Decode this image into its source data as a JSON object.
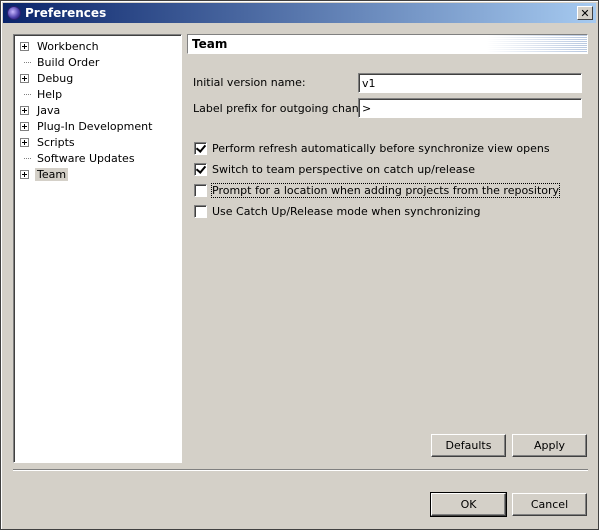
{
  "window": {
    "title": "Preferences",
    "close_glyph": "✕"
  },
  "tree": {
    "items": [
      {
        "label": "Workbench",
        "expandable": true
      },
      {
        "label": "Build Order",
        "expandable": false
      },
      {
        "label": "Debug",
        "expandable": true
      },
      {
        "label": "Help",
        "expandable": false
      },
      {
        "label": "Java",
        "expandable": true
      },
      {
        "label": "Plug-In Development",
        "expandable": true
      },
      {
        "label": "Scripts",
        "expandable": true
      },
      {
        "label": "Software Updates",
        "expandable": false
      },
      {
        "label": "Team",
        "expandable": true,
        "selected": true
      }
    ]
  },
  "page": {
    "title": "Team",
    "fields": {
      "initial_version_label": "Initial version name:",
      "initial_version_value": "v1",
      "label_prefix_label": "Label prefix for outgoing changes:",
      "label_prefix_value": ">"
    },
    "checkboxes": [
      {
        "label": "Perform refresh automatically before synchronize view opens",
        "checked": true
      },
      {
        "label": "Switch to team perspective on catch up/release",
        "checked": true
      },
      {
        "label": "Prompt for a location when adding projects from the repository",
        "checked": false,
        "focused": true
      },
      {
        "label": "Use Catch Up/Release mode when synchronizing",
        "checked": false
      }
    ],
    "defaults_label": "Defaults",
    "apply_label": "Apply"
  },
  "footer": {
    "ok_label": "OK",
    "cancel_label": "Cancel"
  },
  "colors": {
    "titlebar_start": "#0a246a",
    "titlebar_end": "#a6caf0",
    "face": "#d4d0c8"
  }
}
